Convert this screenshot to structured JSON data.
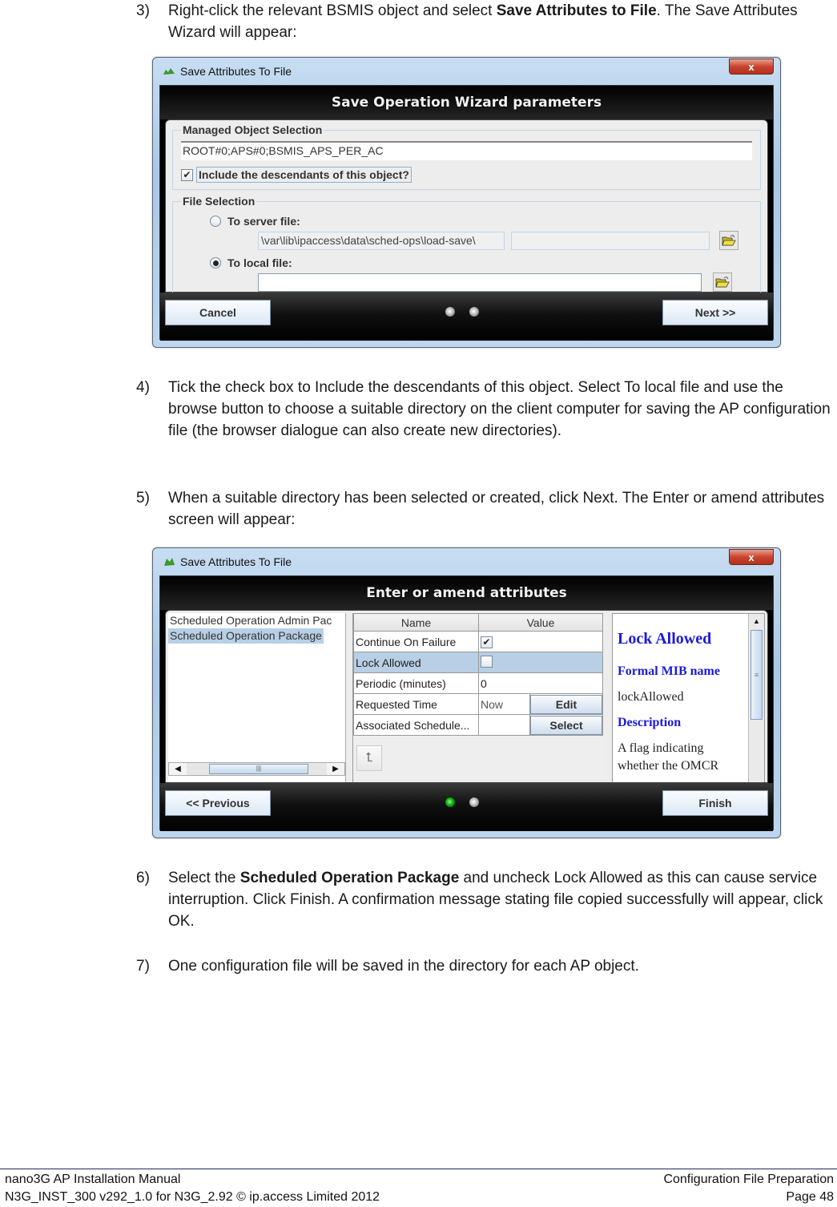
{
  "steps": [
    {
      "num": "3)",
      "text_before": "Right-click the relevant BSMIS object and select ",
      "bold": "Save Attributes to File",
      "text_after": ". The Save Attributes Wizard will appear:"
    },
    {
      "num": "4)",
      "text": "Tick the check box to Include the descendants of this object. Select To local file and use the browse button to choose a suitable directory on the client computer for saving the AP configuration file (the browser dialogue can also create new directories)."
    },
    {
      "num": "5)",
      "text": " When a suitable directory has been selected or created, click Next. The Enter or amend attributes screen will appear:"
    },
    {
      "num": "6)",
      "text_before": "Select the ",
      "bold": "Scheduled Operation Package",
      "text_after": " and uncheck Lock Allowed as this can cause service interruption. Click Finish. A confirmation message stating file copied successfully will appear, click OK."
    },
    {
      "num": "7)",
      "text": "One configuration file will be saved in the directory for each AP object."
    }
  ],
  "window1": {
    "title": "Save Attributes To File",
    "close_label": "x",
    "header": "Save Operation Wizard parameters",
    "mos_legend": "Managed Object Selection",
    "mos_value": "ROOT#0;APS#0;BSMIS_APS_PER_AC",
    "include_descendants_label": "Include the descendants of this object?",
    "include_descendants_checked": true,
    "file_legend": "File Selection",
    "server_file_label": "To server file:",
    "server_path": "\\var\\lib\\ipaccess\\data\\sched-ops\\load-save\\",
    "server_file_name": "",
    "local_file_label": "To local file:",
    "local_file_value": "",
    "selected_option": "local",
    "cancel_label": "Cancel",
    "next_label": "Next >>",
    "step_indicator": {
      "total": 2,
      "active": 0
    }
  },
  "window2": {
    "title": "Save Attributes To File",
    "close_label": "x",
    "header": "Enter or amend attributes",
    "tree_items": [
      {
        "label": "Scheduled Operation Admin Pac",
        "selected": false
      },
      {
        "label": "Scheduled Operation Package",
        "selected": true
      }
    ],
    "table": {
      "headers": [
        "Name",
        "Value"
      ],
      "rows": [
        {
          "name": "Continue On Failure",
          "type": "checkbox",
          "checked": true
        },
        {
          "name": "Lock Allowed",
          "type": "checkbox",
          "checked": false,
          "selected": true
        },
        {
          "name": "Periodic (minutes)",
          "type": "text",
          "value": "0"
        },
        {
          "name": "Requested Time",
          "type": "button",
          "value": "Now",
          "button": "Edit"
        },
        {
          "name": "Associated Schedule...",
          "type": "button",
          "value": "",
          "button": "Select"
        }
      ]
    },
    "help": {
      "title": "Lock Allowed",
      "mib_heading": "Formal MIB name",
      "mib_name": "lockAllowed",
      "desc_heading": "Description",
      "desc_text": "A flag indicating whether the OMCR"
    },
    "previous_label": "<< Previous",
    "finish_label": "Finish",
    "step_indicator": {
      "total": 2,
      "active": 0
    }
  },
  "footer": {
    "left_line1": "nano3G AP Installation Manual",
    "left_line2": "N3G_INST_300 v292_1.0 for N3G_2.92 © ip.access Limited 2012",
    "right_line1": "Configuration File Preparation",
    "right_line2": "Page 48"
  }
}
